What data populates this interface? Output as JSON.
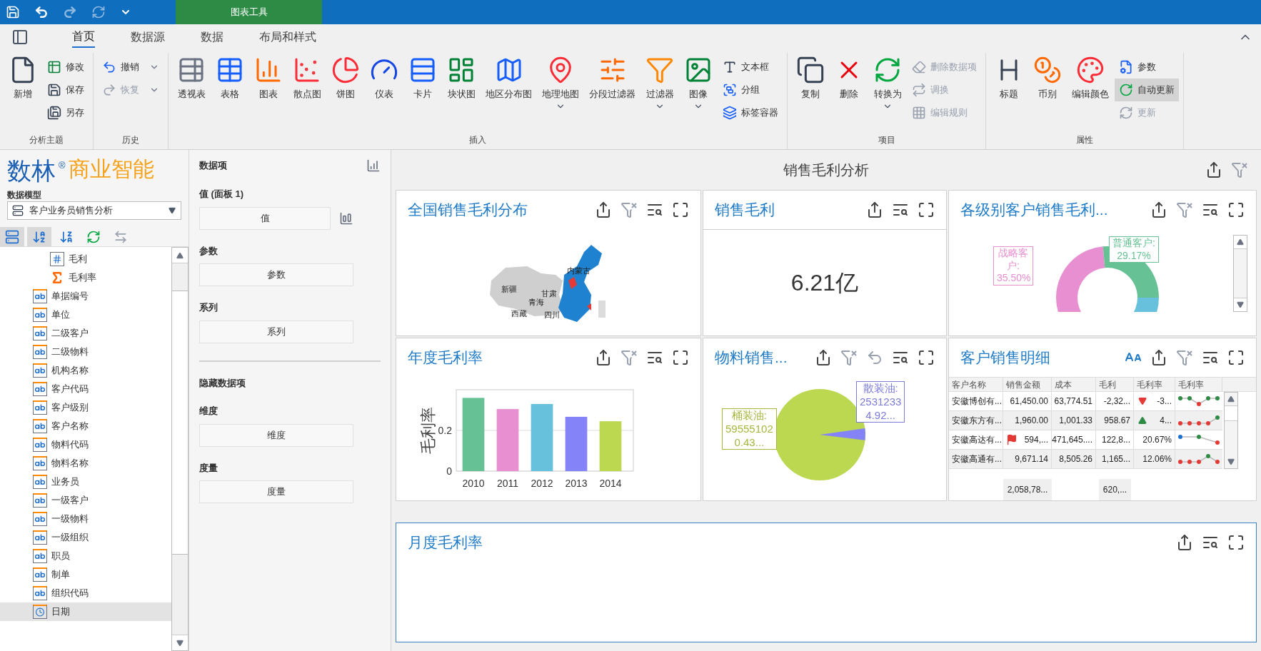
{
  "title_bar": {
    "contextual_tab": "图表工具"
  },
  "ribbon_tabs": [
    {
      "label": "首页",
      "selected": true
    },
    {
      "label": "数据源",
      "selected": false
    },
    {
      "label": "数据",
      "selected": false
    },
    {
      "label": "布局和样式",
      "selected": false
    }
  ],
  "ribbon_groups": [
    {
      "label": "分析主题",
      "items": [
        {
          "kind": "large",
          "label": "新增",
          "menu": false,
          "disabled": false,
          "on": false
        },
        {
          "kind": "small",
          "label": "修改",
          "menu": false,
          "disabled": false,
          "on": false
        },
        {
          "kind": "small",
          "label": "保存",
          "menu": false,
          "disabled": false,
          "on": false
        },
        {
          "kind": "small",
          "label": "另存",
          "menu": false,
          "disabled": false,
          "on": false
        }
      ]
    },
    {
      "label": "历史",
      "items": [
        {
          "kind": "small",
          "label": "撤销",
          "menu": true,
          "disabled": false,
          "on": false
        },
        {
          "kind": "small",
          "label": "恢复",
          "menu": true,
          "disabled": true,
          "on": false
        }
      ]
    },
    {
      "label": "插入",
      "items": [
        {
          "kind": "large",
          "label": "透视表",
          "menu": false,
          "disabled": false,
          "on": false
        },
        {
          "kind": "large",
          "label": "表格",
          "menu": false,
          "disabled": false,
          "on": false
        },
        {
          "kind": "large",
          "label": "图表",
          "menu": false,
          "disabled": false,
          "on": false
        },
        {
          "kind": "large",
          "label": "散点图",
          "menu": false,
          "disabled": false,
          "on": false
        },
        {
          "kind": "large",
          "label": "饼图",
          "menu": false,
          "disabled": false,
          "on": false
        },
        {
          "kind": "large",
          "label": "仪表",
          "menu": false,
          "disabled": false,
          "on": false
        },
        {
          "kind": "large",
          "label": "卡片",
          "menu": false,
          "disabled": false,
          "on": false
        },
        {
          "kind": "large",
          "label": "块状图",
          "menu": false,
          "disabled": false,
          "on": false
        },
        {
          "kind": "large",
          "label": "地区分布图",
          "menu": false,
          "disabled": false,
          "on": false
        },
        {
          "kind": "large",
          "label": "地理地图",
          "menu": true,
          "disabled": false,
          "on": false
        },
        {
          "kind": "large",
          "label": "分段过滤器",
          "menu": false,
          "disabled": false,
          "on": false
        },
        {
          "kind": "large",
          "label": "过滤器",
          "menu": true,
          "disabled": false,
          "on": false
        },
        {
          "kind": "large",
          "label": "图像",
          "menu": true,
          "disabled": false,
          "on": false
        },
        {
          "kind": "small",
          "label": "文本框",
          "menu": false,
          "disabled": false,
          "on": false
        },
        {
          "kind": "small",
          "label": "分组",
          "menu": false,
          "disabled": false,
          "on": false
        },
        {
          "kind": "small",
          "label": "标签容器",
          "menu": false,
          "disabled": false,
          "on": false
        }
      ]
    },
    {
      "label": "项目",
      "items": [
        {
          "kind": "large",
          "label": "复制",
          "menu": false,
          "disabled": false,
          "on": false
        },
        {
          "kind": "large",
          "label": "删除",
          "menu": false,
          "disabled": false,
          "on": false
        },
        {
          "kind": "large",
          "label": "转换为",
          "menu": true,
          "disabled": false,
          "on": false
        },
        {
          "kind": "small",
          "label": "删除数据项",
          "menu": false,
          "disabled": true,
          "on": false
        },
        {
          "kind": "small",
          "label": "调换",
          "menu": false,
          "disabled": true,
          "on": false
        },
        {
          "kind": "small",
          "label": "编辑规则",
          "menu": false,
          "disabled": true,
          "on": false
        }
      ]
    },
    {
      "label": "属性",
      "items": [
        {
          "kind": "large",
          "label": "标题",
          "menu": false,
          "disabled": false,
          "on": false
        },
        {
          "kind": "large",
          "label": "币别",
          "menu": false,
          "disabled": false,
          "on": false
        },
        {
          "kind": "large",
          "label": "编辑颜色",
          "menu": false,
          "disabled": false,
          "on": false
        },
        {
          "kind": "small",
          "label": "参数",
          "menu": false,
          "disabled": false,
          "on": false
        },
        {
          "kind": "small",
          "label": "自动更新",
          "menu": false,
          "disabled": false,
          "on": true
        },
        {
          "kind": "small",
          "label": "更新",
          "menu": false,
          "disabled": true,
          "on": false
        }
      ]
    }
  ],
  "logo": {
    "brand": "数林",
    "mark": "®",
    "product": "商业智能"
  },
  "data_model": {
    "label": "数据模型",
    "value": "客户业务员销售分析"
  },
  "field_tools": [
    {
      "kind": "group",
      "selected": true
    },
    {
      "kind": "sort_az",
      "selected": true
    },
    {
      "kind": "sort_za",
      "selected": false
    },
    {
      "kind": "refresh",
      "selected": false
    },
    {
      "kind": "swap",
      "selected": false
    }
  ],
  "fields": [
    {
      "children": [
        {
          "label": "毛利",
          "kind": "number",
          "selected": false
        },
        {
          "label": "毛利率",
          "kind": "calc",
          "selected": false
        }
      ]
    },
    {
      "label": "单据编号",
      "kind": "text",
      "selected": false
    },
    {
      "label": "单位",
      "kind": "text",
      "selected": false
    },
    {
      "label": "二级客户",
      "kind": "text",
      "selected": false
    },
    {
      "label": "二级物料",
      "kind": "text",
      "selected": false
    },
    {
      "label": "机构名称",
      "kind": "text",
      "selected": false
    },
    {
      "label": "客户代码",
      "kind": "text",
      "selected": false
    },
    {
      "label": "客户级别",
      "kind": "text",
      "selected": false
    },
    {
      "label": "客户名称",
      "kind": "text",
      "selected": false
    },
    {
      "label": "物料代码",
      "kind": "text",
      "selected": false
    },
    {
      "label": "物料名称",
      "kind": "text",
      "selected": false
    },
    {
      "label": "业务员",
      "kind": "text",
      "selected": false
    },
    {
      "label": "一级客户",
      "kind": "text",
      "selected": false
    },
    {
      "label": "一级物料",
      "kind": "text",
      "selected": false
    },
    {
      "label": "一级组织",
      "kind": "text",
      "selected": false
    },
    {
      "label": "职员",
      "kind": "text",
      "selected": false
    },
    {
      "label": "制单",
      "kind": "text",
      "selected": false
    },
    {
      "label": "组织代码",
      "kind": "text",
      "selected": false
    },
    {
      "label": "日期",
      "kind": "date",
      "selected": true
    }
  ],
  "data_items": {
    "title": "数据项",
    "sections": [
      {
        "kind": "value",
        "label": "值 (面板 1)",
        "slot": "值"
      },
      {
        "kind": "plain",
        "label": "参数",
        "slot": "参数"
      },
      {
        "kind": "plain",
        "label": "系列",
        "slot": "系列"
      }
    ],
    "hidden_title": "隐藏数据项",
    "hidden_sections": [
      {
        "label": "维度",
        "slot": "维度"
      },
      {
        "label": "度量",
        "slot": "度量"
      }
    ]
  },
  "dashboard": {
    "title": "销售毛利分析",
    "tools": [
      {
        "kind": "export",
        "disabled": false
      },
      {
        "kind": "clear_filter",
        "disabled": true
      }
    ],
    "panels": [
      {
        "kind": "map",
        "title": "全国销售毛利分布",
        "selected": false,
        "tools": [
          {
            "kind": "export",
            "disabled": false
          },
          {
            "kind": "clear_filter",
            "disabled": true
          },
          {
            "kind": "drill",
            "disabled": false
          },
          {
            "kind": "maximize",
            "disabled": false
          }
        ],
        "labels": [
          "内蒙古",
          "新疆",
          "青海",
          "甘肃",
          "西藏",
          "四川"
        ]
      },
      {
        "kind": "card",
        "title": "销售毛利",
        "selected": false,
        "tools": [
          {
            "kind": "export",
            "disabled": false
          },
          {
            "kind": "drill",
            "disabled": false
          },
          {
            "kind": "maximize",
            "disabled": false
          }
        ],
        "value": "6.21亿"
      },
      {
        "kind": "donut",
        "title": "各级别客户销售毛利...",
        "selected": false,
        "tools": [
          {
            "kind": "export",
            "disabled": false
          },
          {
            "kind": "clear_filter",
            "disabled": true
          },
          {
            "kind": "drill",
            "disabled": false
          },
          {
            "kind": "maximize",
            "disabled": false
          }
        ],
        "slices": [
          {
            "label": "战略客户:",
            "value": "35.50%",
            "color": "#e88fd1"
          },
          {
            "label": "普通客户:",
            "value": "29.17%",
            "color": "#66c194"
          }
        ]
      },
      {
        "kind": "bar",
        "title": "年度毛利率",
        "selected": false,
        "tools": [
          {
            "kind": "export",
            "disabled": false
          },
          {
            "kind": "clear_filter",
            "disabled": true
          },
          {
            "kind": "drill",
            "disabled": false
          },
          {
            "kind": "maximize",
            "disabled": false
          }
        ],
        "chart_data": {
          "type": "bar",
          "ylabel": "毛利率",
          "categories": [
            "2010",
            "2011",
            "2012",
            "2013",
            "2014"
          ],
          "series": [
            {
              "colors": [
                "#66c194",
                "#e88fd1",
                "#67c1dc",
                "#8484f8",
                "#bcd850"
              ],
              "values": [
                0.36,
                0.305,
                0.33,
                0.267,
                0.245
              ]
            }
          ],
          "ylim": [
            0,
            0.4
          ],
          "yticks": [
            0,
            0.2
          ]
        }
      },
      {
        "kind": "pie",
        "title": "物料销售...",
        "selected": false,
        "tools": [
          {
            "kind": "export",
            "disabled": false
          },
          {
            "kind": "clear_filter",
            "disabled": true
          },
          {
            "kind": "undo",
            "disabled": true
          },
          {
            "kind": "drill",
            "disabled": false
          },
          {
            "kind": "maximize",
            "disabled": false
          }
        ],
        "slices": [
          {
            "label": "桶装油:",
            "value": "59555102",
            "share": "0.43...",
            "color": "#a3b83c"
          },
          {
            "label": "散装油:",
            "value": "2531233",
            "share": "4.92...",
            "color": "#7b7bd9"
          }
        ]
      },
      {
        "kind": "table",
        "title": "客户销售明细",
        "selected": false,
        "tools": [
          {
            "kind": "font_size",
            "disabled": false
          },
          {
            "kind": "export",
            "disabled": false
          },
          {
            "kind": "clear_filter",
            "disabled": true
          },
          {
            "kind": "drill",
            "disabled": false
          },
          {
            "kind": "maximize",
            "disabled": false
          }
        ],
        "columns": [
          {
            "label": "客户名称"
          },
          {
            "label": "销售金额",
            "total": "2,058,78..."
          },
          {
            "label": "成本"
          },
          {
            "label": "毛利",
            "total": "620,..."
          },
          {
            "label": "毛利率"
          },
          {
            "label": "毛利率"
          }
        ],
        "rows": [
          {
            "cells": [
              "安徽博创有...",
              "61,450.00",
              "63,774.51",
              "-2,32...",
              "-3..."
            ],
            "arrow_down": true,
            "arrow_up": false,
            "flag": false
          },
          {
            "cells": [
              "安徽东方有...",
              "1,960.00",
              "1,001.33",
              "958.67",
              "4..."
            ],
            "arrow_down": false,
            "arrow_up": true,
            "flag": false
          },
          {
            "cells": [
              "安徽高达有...",
              "594,...",
              "471,645....",
              "122,8...",
              "20.67%"
            ],
            "arrow_down": false,
            "arrow_up": false,
            "flag": true
          },
          {
            "cells": [
              "安徽高通有...",
              "9,671.14",
              "8,505.26",
              "1,165...",
              "12.06%"
            ],
            "arrow_down": false,
            "arrow_up": false,
            "flag": false
          }
        ]
      },
      {
        "kind": "empty",
        "title": "月度毛利率",
        "selected": true,
        "tools": [
          {
            "kind": "export",
            "disabled": false
          },
          {
            "kind": "drill",
            "disabled": false
          },
          {
            "kind": "maximize",
            "disabled": false
          }
        ]
      }
    ]
  }
}
